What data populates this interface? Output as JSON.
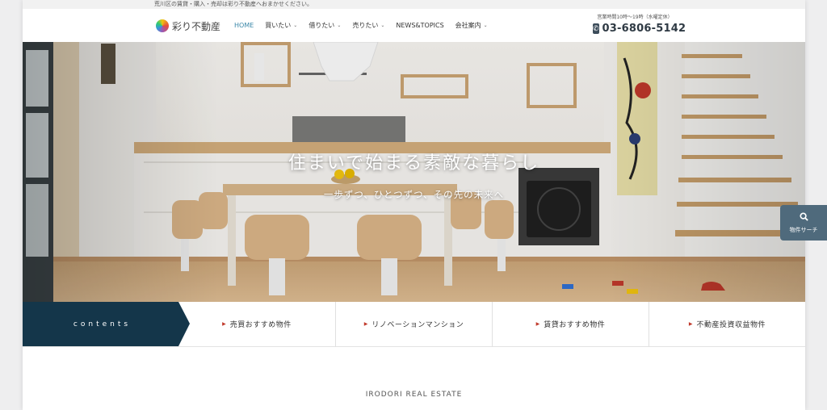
{
  "topbar": {
    "notice": "荒川区の賃貸・購入・売却は彩り不動産へおまかせください。"
  },
  "header": {
    "logo_text": "彩り不動産",
    "nav": [
      {
        "label": "HOME",
        "has_dropdown": false,
        "active": true
      },
      {
        "label": "買いたい",
        "has_dropdown": true,
        "active": false
      },
      {
        "label": "借りたい",
        "has_dropdown": true,
        "active": false
      },
      {
        "label": "売りたい",
        "has_dropdown": true,
        "active": false
      },
      {
        "label": "NEWS&TOPICS",
        "has_dropdown": false,
        "active": false
      },
      {
        "label": "会社案内",
        "has_dropdown": true,
        "active": false
      }
    ],
    "hours": "営業時間10時～19時（水曜定休）",
    "phone": "03-6806-5142",
    "phone_icon": "phone-icon"
  },
  "hero": {
    "title": "住まいで始まる素敵な暮らし",
    "subtitle": "一歩ずつ、ひとつずつ、その先の未来へ"
  },
  "search_button": {
    "label": "物件サーチ",
    "icon": "search-icon"
  },
  "contents_bar": {
    "label": "contents",
    "items": [
      {
        "label": "売買おすすめ物件"
      },
      {
        "label": "リノベーションマンション"
      },
      {
        "label": "賃貸おすすめ物件"
      },
      {
        "label": "不動産投資収益物件"
      }
    ]
  },
  "section": {
    "title": "IRODORI REAL ESTATE"
  },
  "colors": {
    "accent": "#3a87a8",
    "navy": "#14364a",
    "search_button": "#4f6a7c",
    "arrow": "#c0392b"
  }
}
